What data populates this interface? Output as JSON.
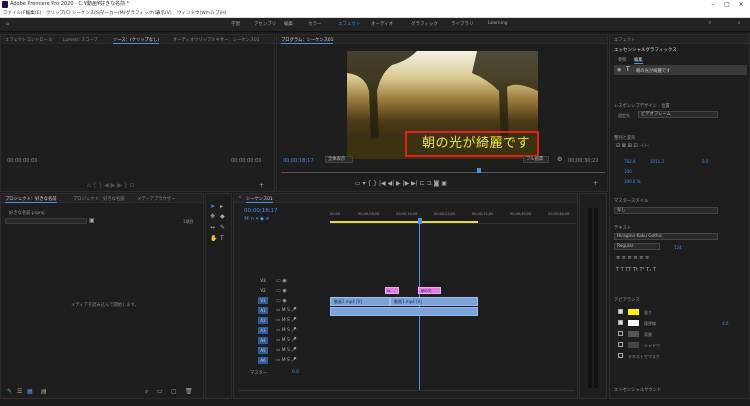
{
  "app": {
    "title": "Adobe Premiere Pro 2020 - C:¥動画¥好きな名前 *"
  },
  "menu": [
    "ファイル(F)",
    "編集(E)",
    "クリップ(C)",
    "シーケンス(S)",
    "マーカー(M)",
    "グラフィック(G)",
    "表示(V)",
    "ウィンドウ(W)",
    "ヘルプ(H)"
  ],
  "workspaces": [
    "学習",
    "アセンブリ",
    "編集",
    "カラー",
    "エフェクト",
    "オーディオ",
    "グラフィック",
    "ライブラリ",
    "Learning"
  ],
  "source_panel": {
    "tabs": [
      "エフェクトコントロール",
      "Lumetri スコープ",
      "ソース：(クリップなし)",
      "オーディオクリップミキサー：シーケンス01"
    ],
    "timecode_left": "00;00;00;00",
    "timecode_right": "00;00;00;00"
  },
  "program": {
    "tab": "プログラム：シーケンス01",
    "caption": "朝の光が綺麗です",
    "timecode": "00;00;18;17",
    "fit": "全体表示",
    "quality": "フル画質",
    "duration": "00;00;30;22"
  },
  "project": {
    "tabs": [
      "プロジェクト：好きな名前",
      "プロジェクト：好きな名前",
      "メディアブラウザー"
    ],
    "file": "好きな名前.prproj",
    "count": "1項目",
    "empty_msg": "メディアを読み込んで開始します。"
  },
  "timeline": {
    "tab": "シーケンス01",
    "timecode": "00;00;18;17",
    "ruler": [
      "00;00",
      "00;00;08;00",
      "00;00;16;00",
      "00;00;24;00",
      "00;00;32;00",
      "00;00;40;00",
      "00;00;48;00"
    ],
    "video_tracks": [
      "V3",
      "V2",
      "V1"
    ],
    "audio_tracks": [
      "A1",
      "A2",
      "A3",
      "A4",
      "A5",
      "A6"
    ],
    "master": "マスター",
    "master_val": "0.0",
    "clip1": "動画1.mp4 [V]",
    "clip2": "動画1.mp4 [V]",
    "gclip": "朝の光",
    "gclip_short": "fx"
  },
  "essential": {
    "title": "エッセンシャルグラフィックス",
    "tabs": [
      "参照",
      "編集"
    ],
    "layer": "朝の光が綺麗です",
    "responsive_label": "レスポンシブデザイン - 位置",
    "pin_label": "固定先",
    "pin_value": "ビデオフレーム",
    "align_label": "整列と変形",
    "pos_x": "782.4",
    "pos_y": "1011.3",
    "rot": "0.0",
    "scale": "100",
    "opacity": "100.0 %",
    "master_style": "マスタースタイル",
    "style_value": "なし",
    "text_label": "テキスト",
    "font": "Hiragino Kaku Gothic",
    "weight": "Regular",
    "size": "124",
    "appearance": "アピアランス",
    "fill": "塗り",
    "stroke": "境界線",
    "stroke_val": "4.0",
    "bg": "背景",
    "shadow": "シャドウ",
    "mask": "テキストでマスク",
    "footer": "エッセンシャルサウンド"
  },
  "colors": {
    "accent": "#4a8fe7",
    "caption_box": "#e0201c",
    "caption_text": "#f0e81e",
    "clip": "#7da4d9",
    "gclip": "#e07ee4",
    "fill_swatch": "#fff200"
  }
}
